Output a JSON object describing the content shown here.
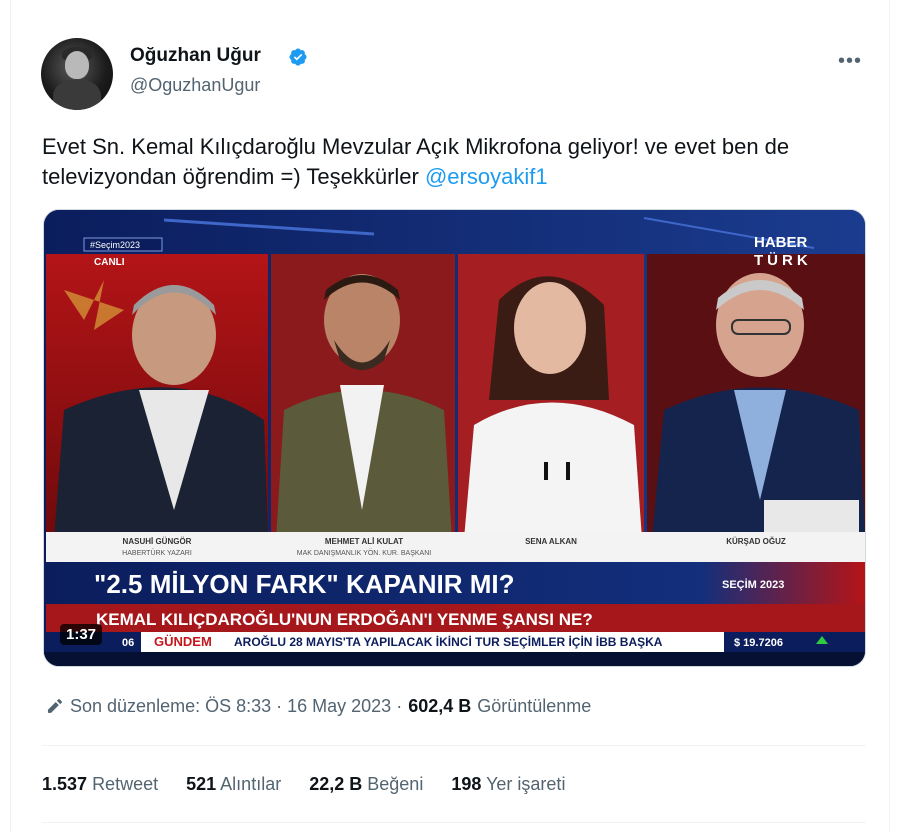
{
  "author": {
    "name": "Oğuzhan Uğur",
    "handle": "@OguzhanUgur"
  },
  "menu_icon": "more-horizontal-icon",
  "tweet": {
    "text": "Evet Sn. Kemal Kılıçdaroğlu Mevzular Açık Mikrofona geliyor! ve evet ben de televizyondan öğrendim =) Teşekkürler ",
    "mention": "@ersoyakif1"
  },
  "video": {
    "duration": "1:37",
    "hashtag": "#Seçim2023",
    "live": "CANLI",
    "channel_line1": "HABER",
    "channel_line2": "TÜRK",
    "panelists": [
      {
        "name": "NASUHİ GÜNGÖR",
        "title": "HABERTÜRK YAZARI"
      },
      {
        "name": "MEHMET ALİ KULAT",
        "title": "MAK DANIŞMANLIK YÖN. KUR. BAŞKANI"
      },
      {
        "name": "SENA ALKAN",
        "title": ""
      },
      {
        "name": "KÜRŞAD OĞUZ",
        "title": ""
      }
    ],
    "headline": "\"2.5 MİLYON FARK\" KAPANIR MI?",
    "headline_tag": "SEÇİM 2023",
    "subheadline": "KEMAL KILIÇDAROĞLU'NUN ERDOĞAN'I YENME ŞANSI NE?",
    "ticker_time": "06",
    "ticker_label": "GÜNDEM",
    "ticker_text": "AROĞLU 28 MAYIS'TA YAPILACAK İKİNCİ TUR SEÇİMLER İÇİN İBB BAŞKA",
    "ticker_price": "$ 19.7206"
  },
  "meta": {
    "edited_label": "Son düzenleme: ÖS 8:33 · 16 May 2023 · ",
    "views_count": "602,4 B",
    "views_label": " Görüntülenme"
  },
  "stats": {
    "retweets": {
      "count": "1.537",
      "label": "Retweet"
    },
    "quotes": {
      "count": "521",
      "label": "Alıntılar"
    },
    "likes": {
      "count": "22,2 B",
      "label": "Beğeni"
    },
    "bookmarks": {
      "count": "198",
      "label": "Yer işareti"
    }
  },
  "colors": {
    "brand_blue": "#1d9bf0",
    "text_primary": "#0f1419",
    "text_secondary": "#536471",
    "broadcast_red": "#c4161c",
    "broadcast_navy": "#0b1d5c"
  }
}
